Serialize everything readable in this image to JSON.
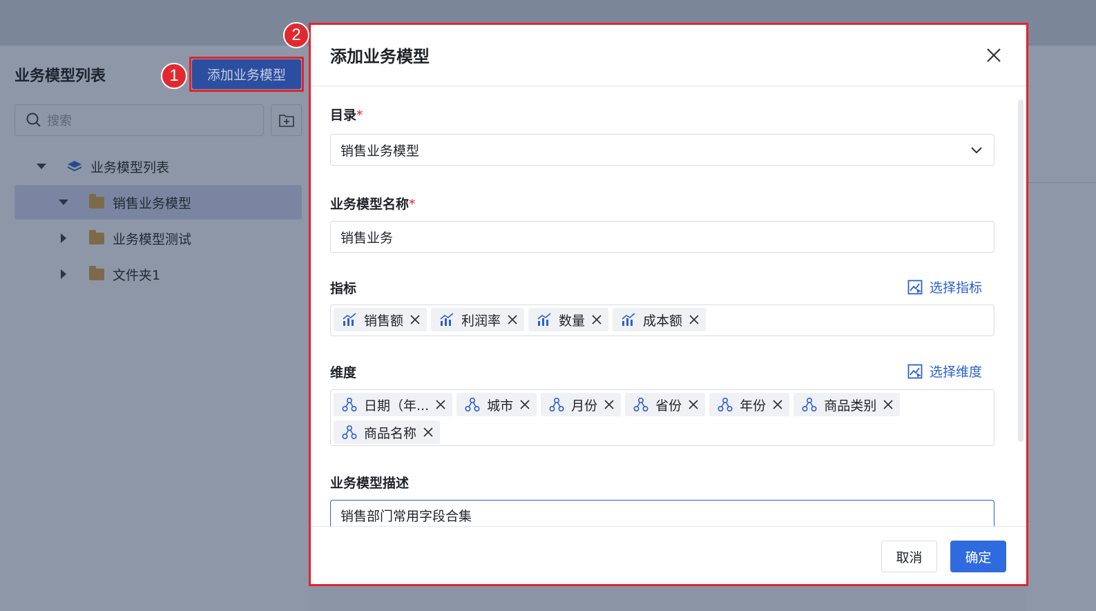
{
  "sidebar": {
    "title": "业务模型列表",
    "add_button": "添加业务模型",
    "search_placeholder": "搜索",
    "tree": {
      "root": "业务模型列表",
      "items": [
        "销售业务模型",
        "业务模型测试",
        "文件夹1"
      ]
    }
  },
  "badges": [
    "1",
    "2"
  ],
  "dialog": {
    "title": "添加业务模型",
    "catalog": {
      "label": "目录",
      "required": "*",
      "value": "销售业务模型"
    },
    "name": {
      "label": "业务模型名称",
      "required": "*",
      "value": "销售业务"
    },
    "metrics": {
      "label": "指标",
      "pick_label": "选择指标",
      "tags": [
        "销售额",
        "利润率",
        "数量",
        "成本额"
      ]
    },
    "dimensions": {
      "label": "维度",
      "pick_label": "选择维度",
      "tags": [
        "日期（年...",
        "城市",
        "月份",
        "省份",
        "年份",
        "商品类别",
        "商品名称"
      ]
    },
    "description": {
      "label": "业务模型描述",
      "value": "销售部门常用字段合集"
    },
    "cancel": "取消",
    "confirm": "确定"
  },
  "colors": {
    "accent": "#2f6bdf",
    "highlight": "#e0242d"
  }
}
